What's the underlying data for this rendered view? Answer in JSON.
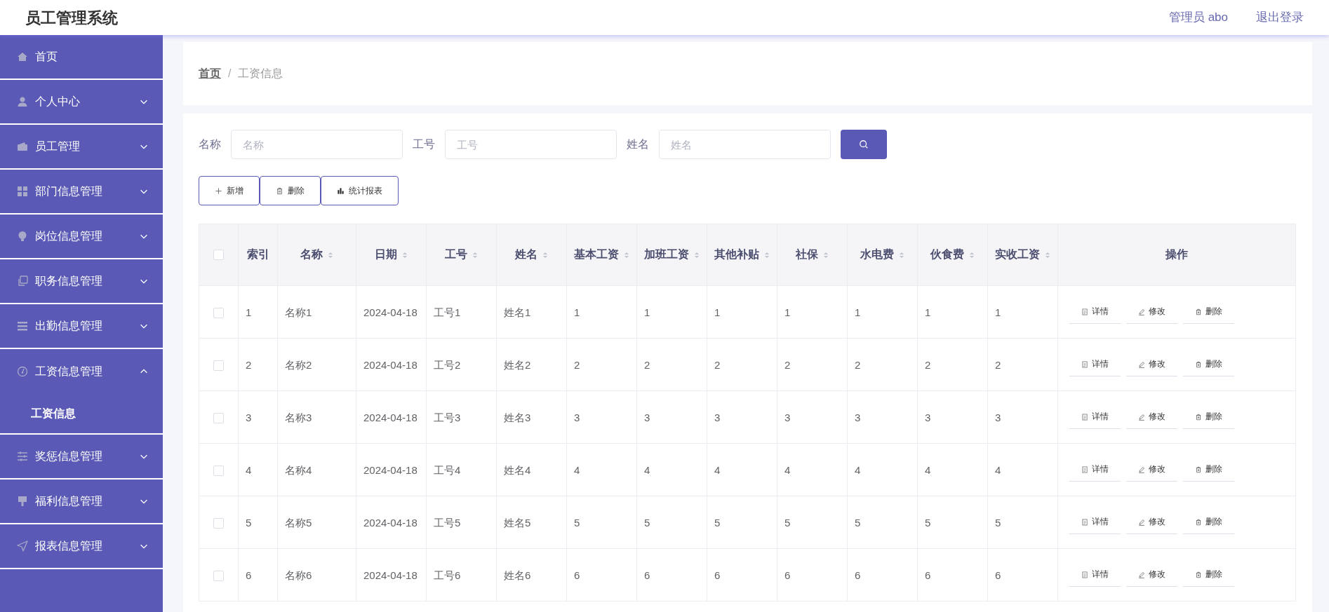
{
  "header": {
    "title": "员工管理系统",
    "user": "管理员 abo",
    "logout": "退出登录"
  },
  "sidebar": {
    "items": [
      {
        "label": "首页"
      },
      {
        "label": "个人中心",
        "expanded": false
      },
      {
        "label": "员工管理",
        "expanded": false
      },
      {
        "label": "部门信息管理",
        "expanded": false
      },
      {
        "label": "岗位信息管理",
        "expanded": false
      },
      {
        "label": "职务信息管理",
        "expanded": false
      },
      {
        "label": "出勤信息管理",
        "expanded": false
      },
      {
        "label": "工资信息管理",
        "expanded": true,
        "children": [
          {
            "label": "工资信息"
          }
        ]
      },
      {
        "label": "奖惩信息管理",
        "expanded": false
      },
      {
        "label": "福利信息管理",
        "expanded": false
      },
      {
        "label": "报表信息管理",
        "expanded": false
      }
    ]
  },
  "breadcrumb": [
    "首页",
    "工资信息"
  ],
  "breadcrumb_separator": "/",
  "filters": [
    {
      "label": "名称",
      "placeholder": "名称"
    },
    {
      "label": "工号",
      "placeholder": "工号"
    },
    {
      "label": "姓名",
      "placeholder": "姓名"
    }
  ],
  "toolbar": [
    {
      "kind": "add",
      "label": "新增"
    },
    {
      "kind": "delete",
      "label": "删除"
    },
    {
      "kind": "chart",
      "label": "统计报表"
    }
  ],
  "table": {
    "select_all_checked": false,
    "columns": [
      {
        "label": "索引",
        "sortable": false
      },
      {
        "label": "名称",
        "sortable": true
      },
      {
        "label": "日期",
        "sortable": true
      },
      {
        "label": "工号",
        "sortable": true
      },
      {
        "label": "姓名",
        "sortable": true
      },
      {
        "label": "基本工资",
        "sortable": true
      },
      {
        "label": "加班工资",
        "sortable": true
      },
      {
        "label": "其他补贴",
        "sortable": true
      },
      {
        "label": "社保",
        "sortable": true
      },
      {
        "label": "水电费",
        "sortable": true
      },
      {
        "label": "伙食费",
        "sortable": true
      },
      {
        "label": "实收工资",
        "sortable": true
      },
      {
        "label": "操作",
        "sortable": false
      }
    ],
    "rows": [
      {
        "checked": false,
        "cells": [
          "1",
          "名称1",
          "2024-04-18",
          "工号1",
          "姓名1",
          "1",
          "1",
          "1",
          "1",
          "1",
          "1",
          "1"
        ],
        "actions": [
          {
            "kind": "detail",
            "label": "详情"
          },
          {
            "kind": "edit",
            "label": "修改"
          },
          {
            "kind": "delete",
            "label": "删除"
          }
        ]
      },
      {
        "checked": false,
        "cells": [
          "2",
          "名称2",
          "2024-04-18",
          "工号2",
          "姓名2",
          "2",
          "2",
          "2",
          "2",
          "2",
          "2",
          "2"
        ],
        "actions": [
          {
            "kind": "detail",
            "label": "详情"
          },
          {
            "kind": "edit",
            "label": "修改"
          },
          {
            "kind": "delete",
            "label": "删除"
          }
        ]
      },
      {
        "checked": false,
        "cells": [
          "3",
          "名称3",
          "2024-04-18",
          "工号3",
          "姓名3",
          "3",
          "3",
          "3",
          "3",
          "3",
          "3",
          "3"
        ],
        "actions": [
          {
            "kind": "detail",
            "label": "详情"
          },
          {
            "kind": "edit",
            "label": "修改"
          },
          {
            "kind": "delete",
            "label": "删除"
          }
        ]
      },
      {
        "checked": false,
        "cells": [
          "4",
          "名称4",
          "2024-04-18",
          "工号4",
          "姓名4",
          "4",
          "4",
          "4",
          "4",
          "4",
          "4",
          "4"
        ],
        "actions": [
          {
            "kind": "detail",
            "label": "详情"
          },
          {
            "kind": "edit",
            "label": "修改"
          },
          {
            "kind": "delete",
            "label": "删除"
          }
        ]
      },
      {
        "checked": false,
        "cells": [
          "5",
          "名称5",
          "2024-04-18",
          "工号5",
          "姓名5",
          "5",
          "5",
          "5",
          "5",
          "5",
          "5",
          "5"
        ],
        "actions": [
          {
            "kind": "detail",
            "label": "详情"
          },
          {
            "kind": "edit",
            "label": "修改"
          },
          {
            "kind": "delete",
            "label": "删除"
          }
        ]
      },
      {
        "checked": false,
        "cells": [
          "6",
          "名称6",
          "2024-04-18",
          "工号6",
          "姓名6",
          "6",
          "6",
          "6",
          "6",
          "6",
          "6",
          "6"
        ],
        "actions": [
          {
            "kind": "detail",
            "label": "详情"
          },
          {
            "kind": "edit",
            "label": "修改"
          },
          {
            "kind": "delete",
            "label": "删除"
          }
        ]
      }
    ]
  }
}
